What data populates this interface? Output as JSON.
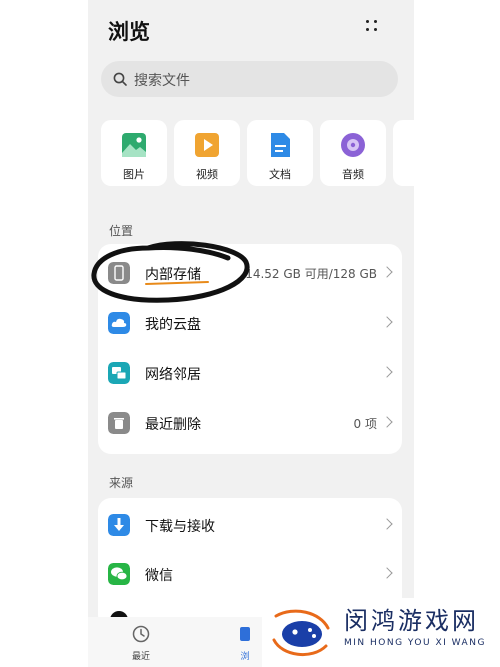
{
  "header": {
    "title": "浏览"
  },
  "search": {
    "placeholder": "搜索文件"
  },
  "categories": [
    {
      "label": "图片",
      "icon": "image-icon",
      "color": "#2eaa6e"
    },
    {
      "label": "视频",
      "icon": "video-icon",
      "color": "#f0a431"
    },
    {
      "label": "文档",
      "icon": "document-icon",
      "color": "#2e8ae6"
    },
    {
      "label": "音频",
      "icon": "audio-icon",
      "color": "#8b62d6"
    }
  ],
  "locations": {
    "heading": "位置",
    "items": [
      {
        "label": "内部存储",
        "value": "14.52 GB 可用/128 GB",
        "icon": "phone-icon",
        "color": "#8a8a8a"
      },
      {
        "label": "我的云盘",
        "value": "",
        "icon": "cloud-icon",
        "color": "#2e8ae6"
      },
      {
        "label": "网络邻居",
        "value": "",
        "icon": "network-icon",
        "color": "#1ba7b5"
      },
      {
        "label": "最近删除",
        "value": "0 项",
        "icon": "trash-icon",
        "color": "#8a8a8a"
      }
    ]
  },
  "sources": {
    "heading": "来源",
    "items": [
      {
        "label": "下载与接收",
        "icon": "download-icon",
        "color": "#2e8ae6"
      },
      {
        "label": "微信",
        "icon": "wechat-icon",
        "color": "#27b545"
      }
    ]
  },
  "tabs": [
    {
      "label": "最近",
      "icon": "clock-icon"
    },
    {
      "label": "浏",
      "icon": "browse-icon"
    }
  ],
  "annotation": {
    "color": "#111111",
    "underline_color": "#e88a1a"
  },
  "watermark": {
    "name": "闵鸿游戏网",
    "subtitle": "MIN HONG YOU XI WANG"
  }
}
